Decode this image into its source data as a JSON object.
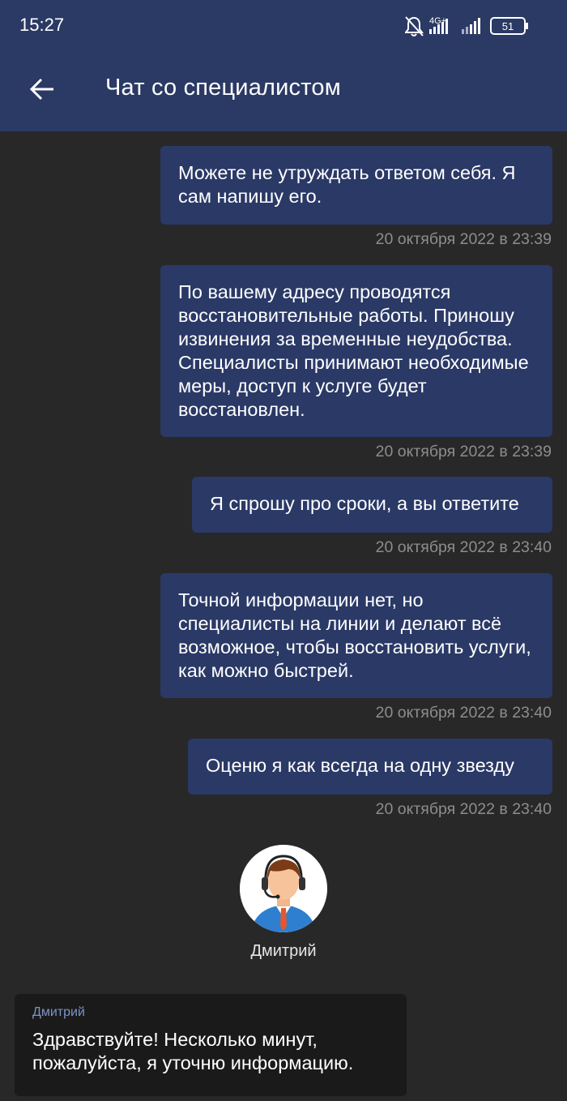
{
  "status_bar": {
    "time": "15:27",
    "network": "4G+",
    "battery": "51",
    "icons": [
      "muted-bell-icon",
      "signal-icon",
      "signal-icon",
      "battery-icon"
    ]
  },
  "header": {
    "back_icon": "arrow-left-icon",
    "title": "Чат со специалистом"
  },
  "messages": [
    {
      "text": "Можете не утруждать ответом себя. Я сам напишу его.",
      "timestamp": "20 октября 2022 в 23:39"
    },
    {
      "text": "По вашему адресу проводятся восстановительные работы. Приношу извинения за временные неудобства. Специалисты принимают необходимые меры, доступ к услуге будет восстановлен.",
      "timestamp": "20 октября 2022 в 23:39"
    },
    {
      "text": "Я спрошу про сроки, а вы ответите",
      "timestamp": "20 октября 2022 в 23:40"
    },
    {
      "text": "Точной информации нет, но специалисты на линии и делают всё возможное, чтобы восстановить услуги, как можно быстрей.",
      "timestamp": "20 октября 2022 в 23:40"
    },
    {
      "text": "Оценю я как всегда на одну звезду",
      "timestamp": "20 октября 2022 в 23:40"
    }
  ],
  "agent": {
    "name": "Дмитрий",
    "avatar_icon": "support-agent-avatar"
  },
  "incoming": {
    "sender": "Дмитрий",
    "text": "Здравствуйте! Несколько минут, пожалуйста, я уточню информацию."
  },
  "colors": {
    "header_bg": "#2b3a64",
    "bubble_out": "#2a3966",
    "bubble_in": "#1a1a1a",
    "chat_bg": "#282828",
    "timestamp": "#8d8d8d",
    "sender_accent": "#7e93c6"
  }
}
